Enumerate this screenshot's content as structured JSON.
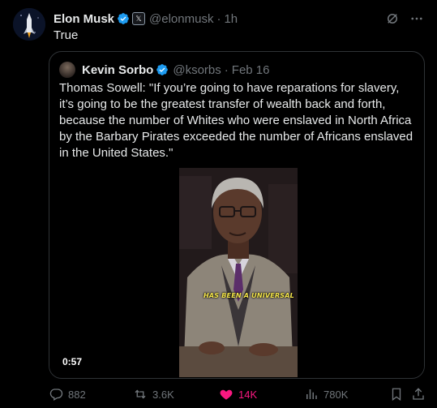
{
  "tweet": {
    "author_name": "Elon Musk",
    "handle": "@elonmusk",
    "time": "1h",
    "separator": "·",
    "text": "True",
    "icons": [
      "verified-badge-icon",
      "x-affiliate-badge-icon",
      "grok-icon",
      "more-icon"
    ]
  },
  "quote": {
    "author_name": "Kevin Sorbo",
    "handle": "@ksorbs",
    "date": "Feb 16",
    "separator": "·",
    "text": "Thomas Sowell: \"If you’re going to have reparations for slavery, it’s going to be the greatest transfer of wealth back and forth, because the number of Whites who were enslaved in North Africa by the Barbary Pirates exceeded the number of Africans enslaved in the United States.\"",
    "video": {
      "caption": "HAS BEEN A UNIVERSAL",
      "duration": "0:57"
    }
  },
  "actions": {
    "replies": "882",
    "reposts": "3.6K",
    "likes": "14K",
    "views": "780K",
    "colors": {
      "muted": "#71767b",
      "like": "#f91880",
      "verified": "#1d9bf0"
    },
    "icons": [
      "reply-icon",
      "repost-icon",
      "like-icon",
      "views-icon",
      "bookmark-icon",
      "share-icon"
    ]
  }
}
